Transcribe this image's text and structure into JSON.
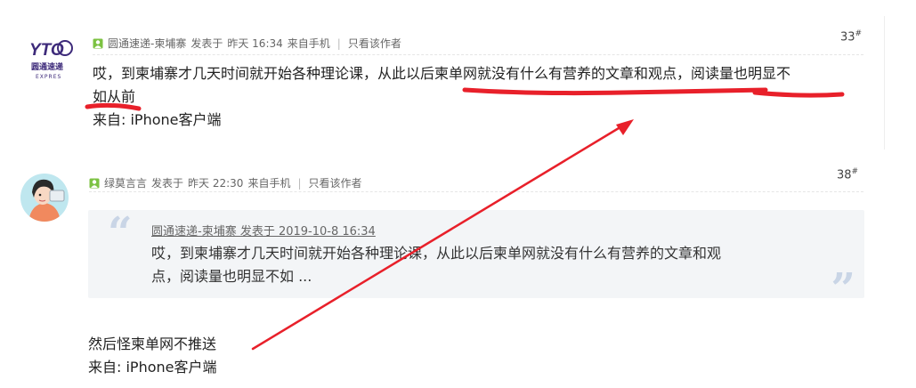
{
  "posts": [
    {
      "author": "圆通速递-柬埔寨",
      "posted_label": "发表于",
      "time": "昨天 16:34",
      "device": "来自手机",
      "only_author": "只看该作者",
      "floor": "33",
      "floor_mark": "#",
      "body_line1": "哎，到柬埔寨才几天时间就开始各种理论课，从此以后柬单网就没有什么有营养的文章和观点，阅读量也明显不",
      "body_line2": "如从前",
      "signature": "来自: iPhone客户端",
      "avatar_logo": "YTO",
      "avatar_sub": "圆通速递",
      "avatar_sub2": "EXPRES"
    },
    {
      "author": "绿莫言言",
      "posted_label": "发表于",
      "time": "昨天 22:30",
      "device": "来自手机",
      "only_author": "只看该作者",
      "floor": "38",
      "floor_mark": "#",
      "quote": {
        "head": "圆通速递-柬埔寨 发表于 2019-10-8 16:34",
        "line1": "哎，到柬埔寨才几天时间就开始各种理论课，从此以后柬单网就没有什么有营养的文章和观",
        "line2": "点，阅读量也明显不如 ..."
      },
      "body": "然后怪柬单网不推送",
      "signature": "来自: iPhone客户端"
    }
  ],
  "colors": {
    "annotation_red": "#e8202a",
    "quote_bg": "#f3f5f7",
    "quote_mark": "#c9d5e6",
    "user_icon_green": "#7cc242"
  },
  "icons": {
    "user": "user-icon",
    "quote_open": "quote-open-icon",
    "quote_close": "quote-close-icon"
  }
}
